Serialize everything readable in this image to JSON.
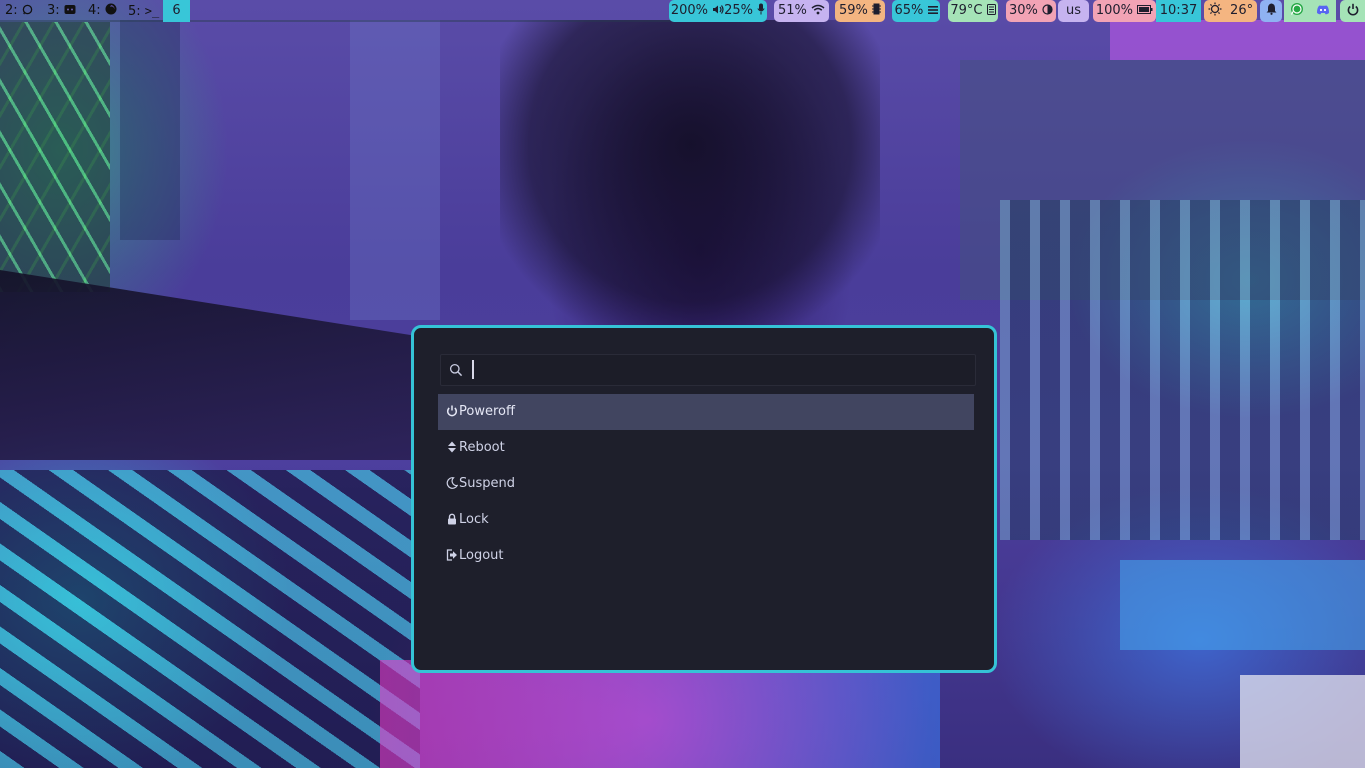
{
  "workspaces": [
    {
      "label": "2:",
      "icon": "whatsapp-icon"
    },
    {
      "label": "3:",
      "icon": "discord-icon"
    },
    {
      "label": "4:",
      "icon": "firefox-icon"
    },
    {
      "label": "5:",
      "icon": "terminal-icon"
    },
    {
      "label": "6",
      "active": true
    }
  ],
  "status": {
    "audio": {
      "volume": "200%",
      "mic": "25%"
    },
    "wifi": "51%",
    "memory": "59%",
    "cpu": "65%",
    "temperature": "79°C",
    "brightness": "30%",
    "keyboard_layout": "us",
    "battery": "100%",
    "clock": "10:37",
    "weather": "26°"
  },
  "tray": [
    "bell-icon",
    "whatsapp-icon",
    "discord-icon",
    "power-icon"
  ],
  "colors": {
    "accent": "#35c3d6",
    "launcher_bg": "#1e1f2b",
    "selected_row": "#414560",
    "pill_cyan": "#38c6d8",
    "pill_lavender": "#c6b3f0",
    "pill_peach": "#f4b581",
    "pill_green": "#a5e3b7",
    "pill_pink": "#f2a3b5",
    "pill_blue": "#8fb2f2"
  },
  "launcher": {
    "search": {
      "value": "",
      "placeholder": ""
    },
    "entries": [
      {
        "label": "Poweroff",
        "icon": "power-icon",
        "selected": true
      },
      {
        "label": "Reboot",
        "icon": "reboot-icon"
      },
      {
        "label": "Suspend",
        "icon": "moon-icon"
      },
      {
        "label": "Lock",
        "icon": "lock-icon"
      },
      {
        "label": "Logout",
        "icon": "logout-icon"
      }
    ]
  }
}
